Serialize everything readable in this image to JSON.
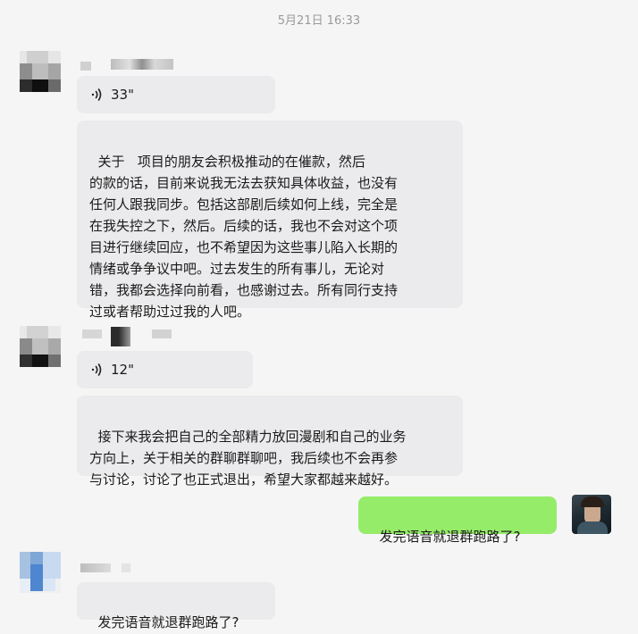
{
  "chat": {
    "timestamp": "5月21日 16:33",
    "messages": [
      {
        "voice": {
          "duration": "33\""
        },
        "text": "关于   项目的朋友会积极推动的在催款，然后\n的款的话，目前来说我无法去获知具体收益，也没有\n任何人跟我同步。包括这部剧后续如何上线，完全是\n在我失控之下，然后。后续的话，我也不会对这个项\n目进行继续回应，也不希望因为这些事儿陷入长期的\n情绪或争争议中吧。过去发生的所有事儿，无论对\n错，我都会选择向前看，也感谢过去。所有同行支持\n过或者帮助过过我的人吧。"
      },
      {
        "voice": {
          "duration": "12\""
        },
        "text": "接下来我会把自己的全部精力放回漫剧和自己的业务\n方向上，关于相关的群聊群聊吧，我后续也不会再参\n与讨论，讨论了也正式退出，希望大家都越来越好。"
      },
      {
        "sent_text": "发完语音就退群跑路了?"
      },
      {
        "text": "发完语音就退群跑路了?"
      }
    ]
  },
  "colors": {
    "background": "#f5f5f5",
    "received_bubble": "#ebebed",
    "sent_bubble": "#95ec69"
  },
  "icons": [
    "voice-wave-icon",
    "avatar"
  ]
}
